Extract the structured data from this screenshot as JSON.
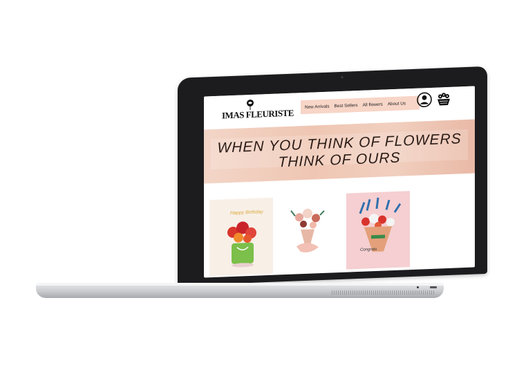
{
  "site": {
    "brand": "IMAS FLEURISTE"
  },
  "nav": {
    "items": [
      "New Arrivals",
      "Best Sellers",
      "All flowers",
      "About Us"
    ]
  },
  "hero": {
    "line1": "WHEN YOU THINK OF FLOWERS",
    "line2": "THINK OF OURS"
  },
  "cards": [
    {
      "caption": "Happy Birthday"
    },
    {
      "caption": ""
    },
    {
      "caption": "Congrats"
    }
  ],
  "colors": {
    "accent": "#f7d5c7",
    "hero": "#efc6b3",
    "text": "#2a1b16"
  }
}
